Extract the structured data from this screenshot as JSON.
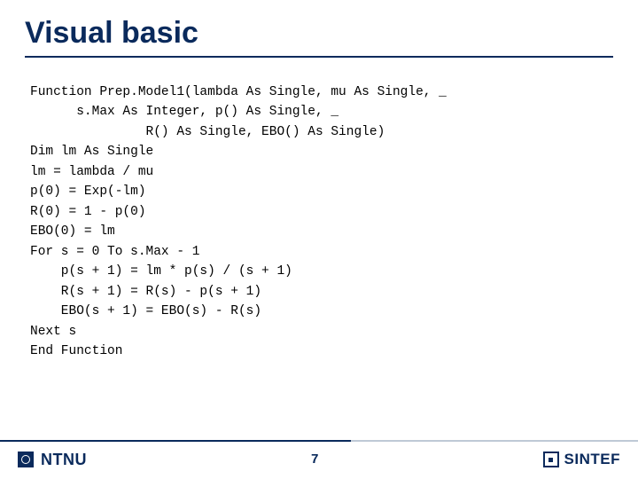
{
  "title": "Visual basic",
  "code": "Function Prep.Model1(lambda As Single, mu As Single, _\n      s.Max As Integer, p() As Single, _\n               R() As Single, EBO() As Single)\nDim lm As Single\nlm = lambda / mu\np(0) = Exp(-lm)\nR(0) = 1 - p(0)\nEBO(0) = lm\nFor s = 0 To s.Max - 1\n    p(s + 1) = lm * p(s) / (s + 1)\n    R(s + 1) = R(s) - p(s + 1)\n    EBO(s + 1) = EBO(s) - R(s)\nNext s\nEnd Function",
  "footer": {
    "left_logo_text": "NTNU",
    "page_number": "7",
    "right_logo_text": "SINTEF"
  }
}
